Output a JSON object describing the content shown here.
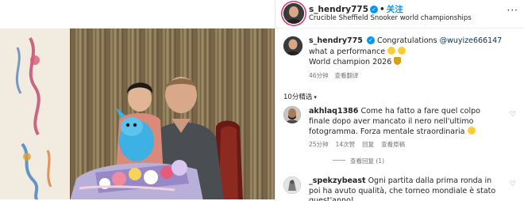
{
  "post": {
    "username": "s_hendry775",
    "verified_mark": "✓",
    "separator": "•",
    "follow_label": "关注",
    "subtitle": "Crucible Sheffield Snooker world championships",
    "more_glyph": "···",
    "photo_alt": "Boy holding a blue plush toy beside a man with flowers"
  },
  "caption": {
    "username": "s_hendry775",
    "text_before": "Congratulations ",
    "mention": "@wuyize666147",
    "text_after": " what a performance ",
    "line2": "World champion 2026 ",
    "time": "46分钟",
    "translate_label": "查看翻译"
  },
  "comments_section": {
    "title": "10分精选",
    "chevron": "▾"
  },
  "comments": [
    {
      "username": "akhlaq1386",
      "text": "Come ha fatto a fare quel colpo finale dopo aver mancato il nero nell'ultimo fotogramma. Forza mentale straordinaria ",
      "time": "25分钟",
      "likes": "14次赞",
      "reply_label": "回复",
      "translate_label": "查看原稿",
      "view_replies": "查看回复 (1)"
    },
    {
      "username": "_spekzybeast",
      "text": "Ogni partita dalla prima ronda in poi ha avuto qualità, che torneo mondiale è stato quest'anno!"
    }
  ],
  "icons": {
    "heart": "♡"
  },
  "colors": {
    "link_blue": "#0095f6",
    "mention_blue": "#00376b",
    "meta_gray": "#737373",
    "story_ring": "#e1306c"
  }
}
